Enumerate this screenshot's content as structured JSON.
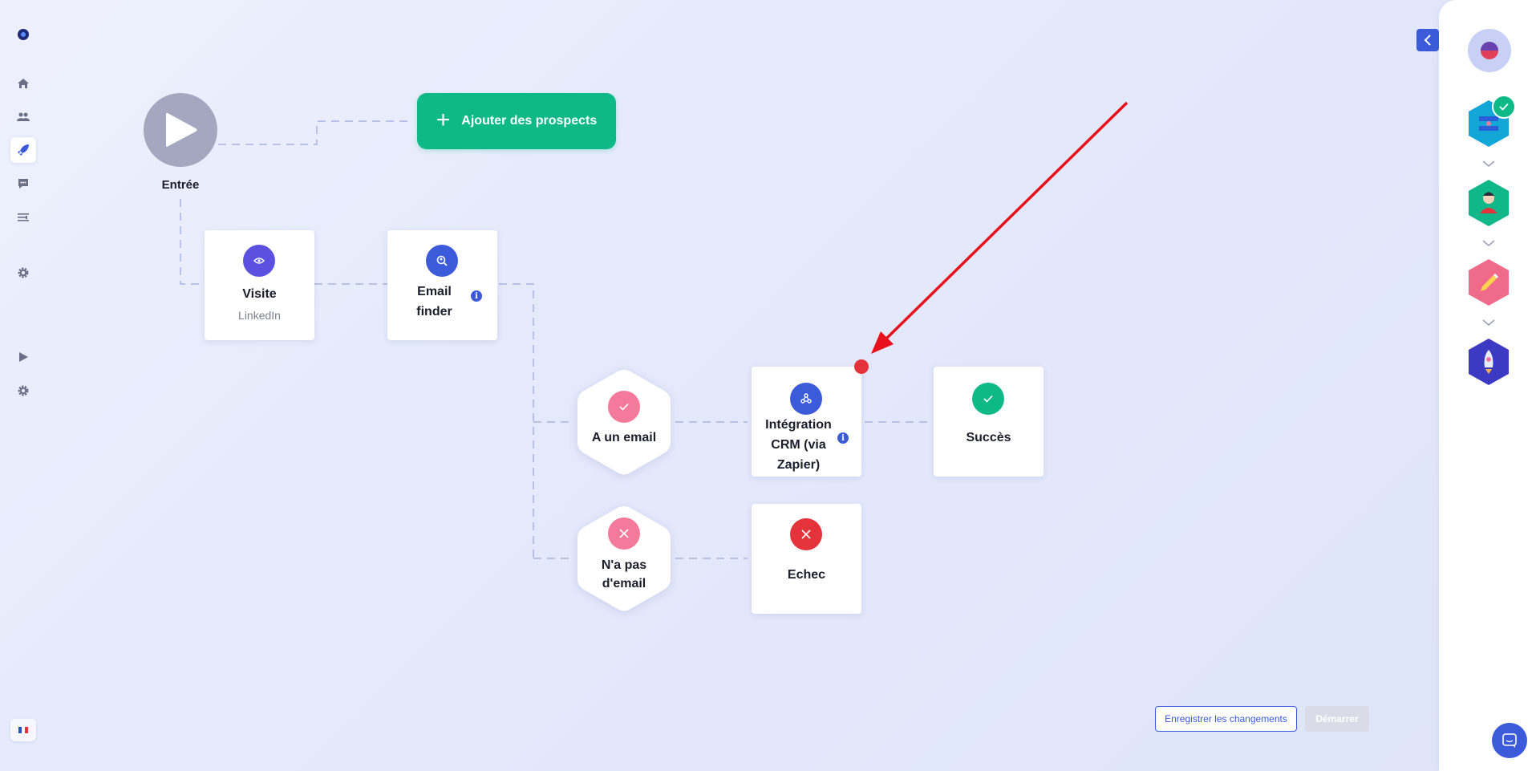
{
  "nav": {
    "items": [
      {
        "name": "logo-icon"
      },
      {
        "name": "home-icon"
      },
      {
        "name": "users-icon"
      },
      {
        "name": "rocket-icon",
        "active": true
      },
      {
        "name": "chat-icon"
      },
      {
        "name": "filters-icon"
      },
      {
        "name": "gear-icon"
      },
      {
        "name": "play-icon"
      },
      {
        "name": "gear-icon"
      }
    ],
    "language": "fr"
  },
  "workflow": {
    "entry_label": "Entrée",
    "add_prospects_label": "Ajouter des prospects",
    "visit": {
      "title": "Visite",
      "subtitle": "LinkedIn"
    },
    "email_finder": {
      "title_line1": "Email",
      "title_line2": "finder",
      "info": "i"
    },
    "has_email": {
      "title": "A un email"
    },
    "no_email": {
      "title_line1": "N'a pas",
      "title_line2": "d'email"
    },
    "crm": {
      "title_line1": "Intégration",
      "title_line2": "CRM (via",
      "title_line3": "Zapier)",
      "info": "i"
    },
    "success": {
      "title": "Succès"
    },
    "failure": {
      "title": "Echec"
    }
  },
  "footer": {
    "save_label": "Enregistrer les changements",
    "start_label": "Démarrer"
  },
  "right_panel": {
    "steps": [
      {
        "name": "prospects-step-icon",
        "color": "#12a7d6",
        "done": true
      },
      {
        "name": "profile-step-icon",
        "color": "#10b889"
      },
      {
        "name": "write-step-icon",
        "color": "#f06a8a"
      },
      {
        "name": "launch-step-icon",
        "color": "#3c3ac2"
      }
    ]
  },
  "colors": {
    "accent": "#3b5bdb",
    "green": "#0dba87",
    "pink": "#f37a9a",
    "red": "#e5333b",
    "purple": "#5b50e0"
  }
}
